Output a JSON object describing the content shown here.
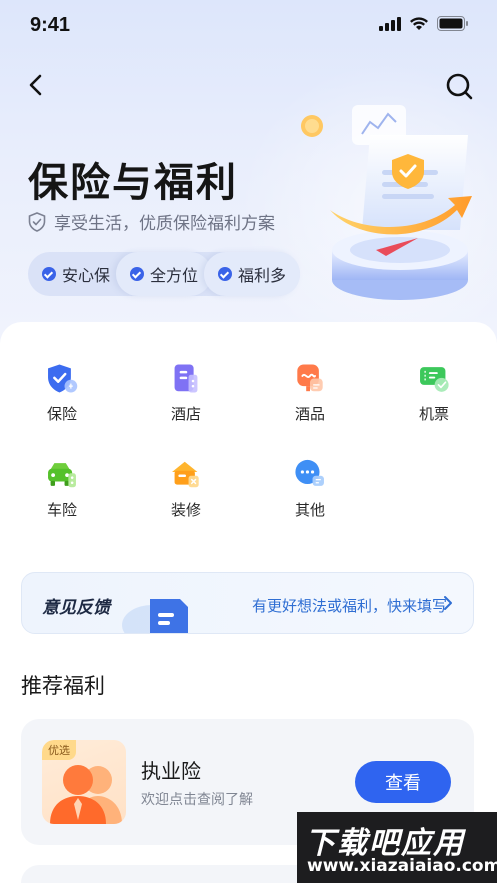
{
  "status_bar": {
    "time": "9:41"
  },
  "header": {
    "title": "保险与福利",
    "subtitle": "享受生活，优质保险福利方案",
    "tags": [
      "安心保",
      "全方位",
      "福利多"
    ]
  },
  "categories": [
    {
      "label": "保险",
      "icon": "insurance-shield-icon"
    },
    {
      "label": "酒店",
      "icon": "hotel-building-icon"
    },
    {
      "label": "酒品",
      "icon": "wine-glass-icon"
    },
    {
      "label": "机票",
      "icon": "airline-ticket-icon"
    },
    {
      "label": "车险",
      "icon": "car-insurance-icon"
    },
    {
      "label": "装修",
      "icon": "renovation-house-icon"
    },
    {
      "label": "其他",
      "icon": "chat-bubble-icon"
    }
  ],
  "feedback": {
    "title": "意见反馈",
    "description": "有更好想法或福利，快来填写"
  },
  "recommend": {
    "section_title": "推荐福利",
    "items": [
      {
        "badge": "优选",
        "title": "执业险",
        "description": "欢迎点击查阅了解",
        "button": "查看"
      }
    ]
  },
  "watermark": {
    "title": "下载吧应用",
    "url": "www.xiazaiaiao.com"
  },
  "colors": {
    "accent": "#2f64f0",
    "link": "#2f6ed3",
    "hero_bg": "#dde6fb"
  }
}
